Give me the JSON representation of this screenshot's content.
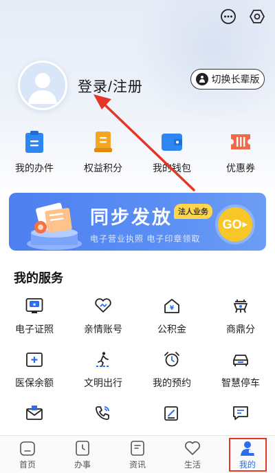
{
  "header": {
    "icons": [
      "more-icon",
      "settings-icon"
    ]
  },
  "profile": {
    "login_label": "登录/注册",
    "elder_mode_label": "切换长辈版"
  },
  "quick_actions": [
    {
      "label": "我的办件",
      "icon": "clipboard-icon",
      "color": "#2e86f3"
    },
    {
      "label": "权益积分",
      "icon": "scroll-icon",
      "color": "#f2a623"
    },
    {
      "label": "我的钱包",
      "icon": "wallet-icon",
      "color": "#2e86f3"
    },
    {
      "label": "优惠券",
      "icon": "coupon-icon",
      "color": "#f06a4a"
    }
  ],
  "banner": {
    "title": "同步发放",
    "badge": "法人业务",
    "subtitle": "电子营业执照  电子印章领取",
    "go_label": "GO"
  },
  "services": {
    "title": "我的服务",
    "items": [
      {
        "label": "电子证照",
        "icon": "id-card-icon"
      },
      {
        "label": "亲情账号",
        "icon": "heart-link-icon"
      },
      {
        "label": "公积金",
        "icon": "house-yen-icon"
      },
      {
        "label": "商鼎分",
        "icon": "tripod-icon"
      },
      {
        "label": "医保余额",
        "icon": "medical-card-icon"
      },
      {
        "label": "文明出行",
        "icon": "pedestrian-icon"
      },
      {
        "label": "我的预约",
        "icon": "alarm-clock-icon"
      },
      {
        "label": "智慧停车",
        "icon": "car-icon"
      },
      {
        "label": "",
        "icon": "mail-icon"
      },
      {
        "label": "",
        "icon": "phone-icon"
      },
      {
        "label": "",
        "icon": "edit-doc-icon"
      },
      {
        "label": "",
        "icon": "message-icon"
      }
    ]
  },
  "tabbar": {
    "tabs": [
      {
        "label": "首页",
        "icon": "home-icon"
      },
      {
        "label": "办事",
        "icon": "clock-doc-icon"
      },
      {
        "label": "资讯",
        "icon": "news-icon"
      },
      {
        "label": "生活",
        "icon": "heart-icon"
      },
      {
        "label": "我的",
        "icon": "user-icon",
        "active": true
      }
    ]
  },
  "colors": {
    "accent": "#2a6ff0",
    "banner": "#4d7ff0",
    "highlight": "#e53524",
    "go_button": "#f7c72a"
  }
}
